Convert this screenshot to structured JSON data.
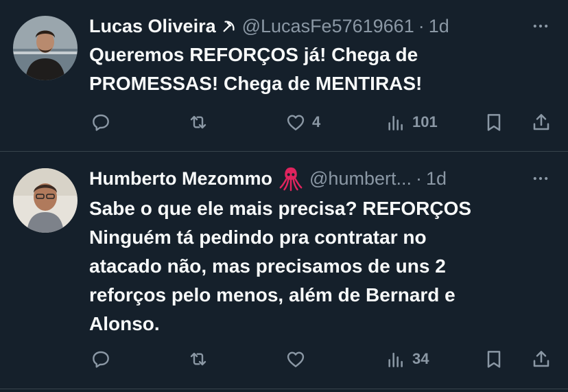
{
  "tweets": [
    {
      "name": "Lucas Oliveira",
      "badge_icon": "hammer-sickle-icon",
      "handle": "@LucasFe57619661",
      "separator": "·",
      "time": "1d",
      "text_lines": [
        "Queremos REFORÇOS já! Chega de",
        "PROMESSAS! Chega de MENTIRAS!"
      ],
      "likes": "4",
      "views": "101"
    },
    {
      "name": "Humberto Mezommo",
      "badge_icon": "squid-emoji-icon",
      "handle": "@humbert...",
      "separator": "·",
      "time": "1d",
      "text_lines": [
        "Sabe o que ele mais precisa? REFORÇOS",
        "Ninguém tá pedindo pra contratar no",
        "atacado não, mas precisamos de uns 2",
        "reforços pelo menos, além de Bernard e",
        "Alonso."
      ],
      "views": "34"
    }
  ],
  "colors": {
    "background": "#15202b",
    "text": "#f7f9f9",
    "secondary": "#8b98a5",
    "divider": "#38444d",
    "squid": "#e0245e"
  }
}
